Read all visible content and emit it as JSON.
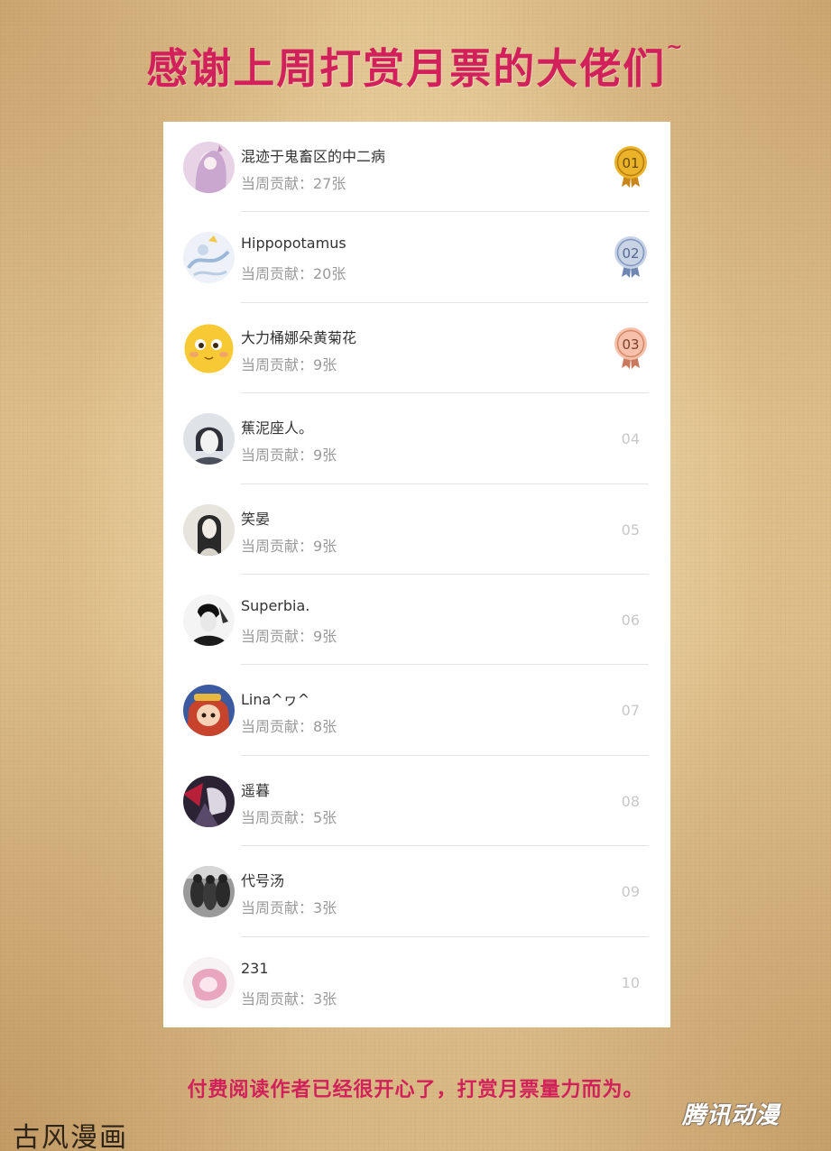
{
  "headline": {
    "text": "感谢上周打赏月票的大佬们",
    "tilde": "~"
  },
  "colors": {
    "accent": "#d1205a",
    "medal_gold": "#e2a91a",
    "medal_silver": "#8fa3c8",
    "medal_bronze": "#e79d82"
  },
  "ranking": [
    {
      "name": "混迹于鬼畜区的中二病",
      "contribution": "当周贡献：27张",
      "rank": "01",
      "medal": "gold",
      "avatar": "anime-girl"
    },
    {
      "name": "Hippopotamus",
      "contribution": "当周贡献：20张",
      "rank": "02",
      "medal": "silver",
      "avatar": "blue-sketch"
    },
    {
      "name": "大力桶娜朵黄菊花",
      "contribution": "当周贡献：9张",
      "rank": "03",
      "medal": "bronze",
      "avatar": "yellow-emoji"
    },
    {
      "name": "蕉泥座人。",
      "contribution": "当周贡献：9张",
      "rank": "04",
      "medal": "none",
      "avatar": "ink-portrait"
    },
    {
      "name": "笑晏",
      "contribution": "当周贡献：9张",
      "rank": "05",
      "medal": "none",
      "avatar": "woman-portrait"
    },
    {
      "name": "Superbia.",
      "contribution": "当周贡献：9张",
      "rank": "06",
      "medal": "none",
      "avatar": "bw-man"
    },
    {
      "name": " Lina^ヮ^",
      "contribution": "当周贡献：8张",
      "rank": "07",
      "medal": "none",
      "avatar": "doll-girl"
    },
    {
      "name": "遥暮",
      "contribution": "当周贡献：5张",
      "rank": "08",
      "medal": "none",
      "avatar": "dark-art"
    },
    {
      "name": "代号汤",
      "contribution": "当周贡献：3张",
      "rank": "09",
      "medal": "none",
      "avatar": "soldiers"
    },
    {
      "name": "231",
      "contribution": "当周贡献：3张",
      "rank": "10",
      "medal": "none",
      "avatar": "pink-splash"
    }
  ],
  "footer": {
    "text": "付费阅读作者已经很开心了，打赏月票量力而为。"
  },
  "watermarks": {
    "left": "古风漫画",
    "right": "腾讯动漫"
  }
}
